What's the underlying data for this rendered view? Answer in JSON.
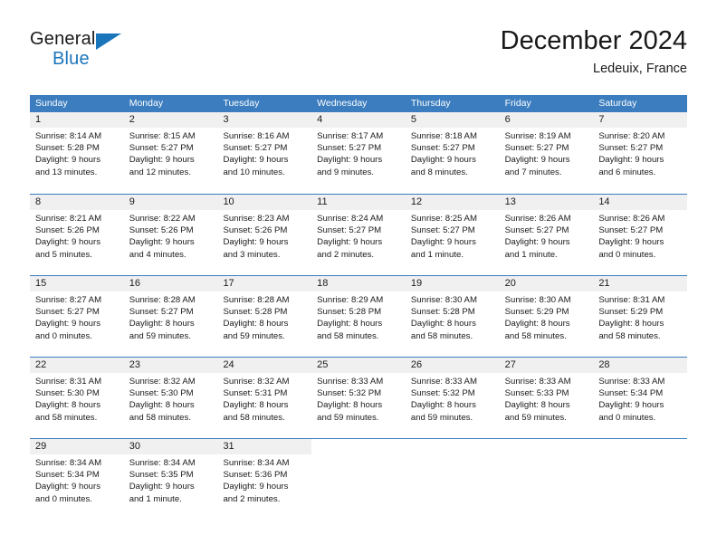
{
  "brand": {
    "word_one": "General",
    "word_two": "Blue",
    "triangle_icon": "triangle-icon",
    "accent_color": "#1b75bb"
  },
  "header": {
    "month_title": "December 2024",
    "location": "Ledeuix, France"
  },
  "theme": {
    "header_bar_color": "#3b7dbf",
    "day_strip_color": "#f0f0f0",
    "text_color": "#1a1a1a"
  },
  "weekdays": [
    "Sunday",
    "Monday",
    "Tuesday",
    "Wednesday",
    "Thursday",
    "Friday",
    "Saturday"
  ],
  "weeks": [
    [
      {
        "day": "1",
        "sunrise": "Sunrise: 8:14 AM",
        "sunset": "Sunset: 5:28 PM",
        "daylight_1": "Daylight: 9 hours",
        "daylight_2": "and 13 minutes."
      },
      {
        "day": "2",
        "sunrise": "Sunrise: 8:15 AM",
        "sunset": "Sunset: 5:27 PM",
        "daylight_1": "Daylight: 9 hours",
        "daylight_2": "and 12 minutes."
      },
      {
        "day": "3",
        "sunrise": "Sunrise: 8:16 AM",
        "sunset": "Sunset: 5:27 PM",
        "daylight_1": "Daylight: 9 hours",
        "daylight_2": "and 10 minutes."
      },
      {
        "day": "4",
        "sunrise": "Sunrise: 8:17 AM",
        "sunset": "Sunset: 5:27 PM",
        "daylight_1": "Daylight: 9 hours",
        "daylight_2": "and 9 minutes."
      },
      {
        "day": "5",
        "sunrise": "Sunrise: 8:18 AM",
        "sunset": "Sunset: 5:27 PM",
        "daylight_1": "Daylight: 9 hours",
        "daylight_2": "and 8 minutes."
      },
      {
        "day": "6",
        "sunrise": "Sunrise: 8:19 AM",
        "sunset": "Sunset: 5:27 PM",
        "daylight_1": "Daylight: 9 hours",
        "daylight_2": "and 7 minutes."
      },
      {
        "day": "7",
        "sunrise": "Sunrise: 8:20 AM",
        "sunset": "Sunset: 5:27 PM",
        "daylight_1": "Daylight: 9 hours",
        "daylight_2": "and 6 minutes."
      }
    ],
    [
      {
        "day": "8",
        "sunrise": "Sunrise: 8:21 AM",
        "sunset": "Sunset: 5:26 PM",
        "daylight_1": "Daylight: 9 hours",
        "daylight_2": "and 5 minutes."
      },
      {
        "day": "9",
        "sunrise": "Sunrise: 8:22 AM",
        "sunset": "Sunset: 5:26 PM",
        "daylight_1": "Daylight: 9 hours",
        "daylight_2": "and 4 minutes."
      },
      {
        "day": "10",
        "sunrise": "Sunrise: 8:23 AM",
        "sunset": "Sunset: 5:26 PM",
        "daylight_1": "Daylight: 9 hours",
        "daylight_2": "and 3 minutes."
      },
      {
        "day": "11",
        "sunrise": "Sunrise: 8:24 AM",
        "sunset": "Sunset: 5:27 PM",
        "daylight_1": "Daylight: 9 hours",
        "daylight_2": "and 2 minutes."
      },
      {
        "day": "12",
        "sunrise": "Sunrise: 8:25 AM",
        "sunset": "Sunset: 5:27 PM",
        "daylight_1": "Daylight: 9 hours",
        "daylight_2": "and 1 minute."
      },
      {
        "day": "13",
        "sunrise": "Sunrise: 8:26 AM",
        "sunset": "Sunset: 5:27 PM",
        "daylight_1": "Daylight: 9 hours",
        "daylight_2": "and 1 minute."
      },
      {
        "day": "14",
        "sunrise": "Sunrise: 8:26 AM",
        "sunset": "Sunset: 5:27 PM",
        "daylight_1": "Daylight: 9 hours",
        "daylight_2": "and 0 minutes."
      }
    ],
    [
      {
        "day": "15",
        "sunrise": "Sunrise: 8:27 AM",
        "sunset": "Sunset: 5:27 PM",
        "daylight_1": "Daylight: 9 hours",
        "daylight_2": "and 0 minutes."
      },
      {
        "day": "16",
        "sunrise": "Sunrise: 8:28 AM",
        "sunset": "Sunset: 5:27 PM",
        "daylight_1": "Daylight: 8 hours",
        "daylight_2": "and 59 minutes."
      },
      {
        "day": "17",
        "sunrise": "Sunrise: 8:28 AM",
        "sunset": "Sunset: 5:28 PM",
        "daylight_1": "Daylight: 8 hours",
        "daylight_2": "and 59 minutes."
      },
      {
        "day": "18",
        "sunrise": "Sunrise: 8:29 AM",
        "sunset": "Sunset: 5:28 PM",
        "daylight_1": "Daylight: 8 hours",
        "daylight_2": "and 58 minutes."
      },
      {
        "day": "19",
        "sunrise": "Sunrise: 8:30 AM",
        "sunset": "Sunset: 5:28 PM",
        "daylight_1": "Daylight: 8 hours",
        "daylight_2": "and 58 minutes."
      },
      {
        "day": "20",
        "sunrise": "Sunrise: 8:30 AM",
        "sunset": "Sunset: 5:29 PM",
        "daylight_1": "Daylight: 8 hours",
        "daylight_2": "and 58 minutes."
      },
      {
        "day": "21",
        "sunrise": "Sunrise: 8:31 AM",
        "sunset": "Sunset: 5:29 PM",
        "daylight_1": "Daylight: 8 hours",
        "daylight_2": "and 58 minutes."
      }
    ],
    [
      {
        "day": "22",
        "sunrise": "Sunrise: 8:31 AM",
        "sunset": "Sunset: 5:30 PM",
        "daylight_1": "Daylight: 8 hours",
        "daylight_2": "and 58 minutes."
      },
      {
        "day": "23",
        "sunrise": "Sunrise: 8:32 AM",
        "sunset": "Sunset: 5:30 PM",
        "daylight_1": "Daylight: 8 hours",
        "daylight_2": "and 58 minutes."
      },
      {
        "day": "24",
        "sunrise": "Sunrise: 8:32 AM",
        "sunset": "Sunset: 5:31 PM",
        "daylight_1": "Daylight: 8 hours",
        "daylight_2": "and 58 minutes."
      },
      {
        "day": "25",
        "sunrise": "Sunrise: 8:33 AM",
        "sunset": "Sunset: 5:32 PM",
        "daylight_1": "Daylight: 8 hours",
        "daylight_2": "and 59 minutes."
      },
      {
        "day": "26",
        "sunrise": "Sunrise: 8:33 AM",
        "sunset": "Sunset: 5:32 PM",
        "daylight_1": "Daylight: 8 hours",
        "daylight_2": "and 59 minutes."
      },
      {
        "day": "27",
        "sunrise": "Sunrise: 8:33 AM",
        "sunset": "Sunset: 5:33 PM",
        "daylight_1": "Daylight: 8 hours",
        "daylight_2": "and 59 minutes."
      },
      {
        "day": "28",
        "sunrise": "Sunrise: 8:33 AM",
        "sunset": "Sunset: 5:34 PM",
        "daylight_1": "Daylight: 9 hours",
        "daylight_2": "and 0 minutes."
      }
    ],
    [
      {
        "day": "29",
        "sunrise": "Sunrise: 8:34 AM",
        "sunset": "Sunset: 5:34 PM",
        "daylight_1": "Daylight: 9 hours",
        "daylight_2": "and 0 minutes."
      },
      {
        "day": "30",
        "sunrise": "Sunrise: 8:34 AM",
        "sunset": "Sunset: 5:35 PM",
        "daylight_1": "Daylight: 9 hours",
        "daylight_2": "and 1 minute."
      },
      {
        "day": "31",
        "sunrise": "Sunrise: 8:34 AM",
        "sunset": "Sunset: 5:36 PM",
        "daylight_1": "Daylight: 9 hours",
        "daylight_2": "and 2 minutes."
      },
      {
        "day": "",
        "sunrise": "",
        "sunset": "",
        "daylight_1": "",
        "daylight_2": ""
      },
      {
        "day": "",
        "sunrise": "",
        "sunset": "",
        "daylight_1": "",
        "daylight_2": ""
      },
      {
        "day": "",
        "sunrise": "",
        "sunset": "",
        "daylight_1": "",
        "daylight_2": ""
      },
      {
        "day": "",
        "sunrise": "",
        "sunset": "",
        "daylight_1": "",
        "daylight_2": ""
      }
    ]
  ]
}
